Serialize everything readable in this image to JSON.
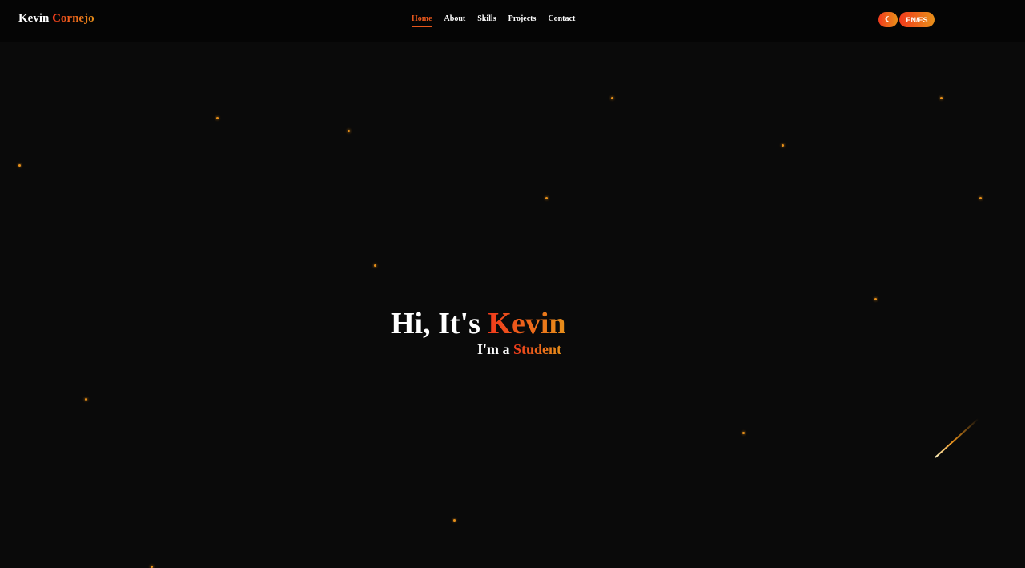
{
  "logo": {
    "first": "Kevin",
    "last": "Cornejo"
  },
  "nav": {
    "items": [
      "Home",
      "About",
      "Skills",
      "Projects",
      "Contact"
    ],
    "active": "Home"
  },
  "controls": {
    "theme_icon": "moon-icon",
    "theme_glyph": "☾",
    "lang_label": "EN/ES"
  },
  "hero": {
    "greeting": "Hi, It's",
    "name": "Kevin",
    "sub_prefix": "I'm a",
    "role": "Student"
  },
  "colors": {
    "accent_start": "#f03a1c",
    "accent_end": "#e8901a",
    "background": "#0a0a0a"
  }
}
